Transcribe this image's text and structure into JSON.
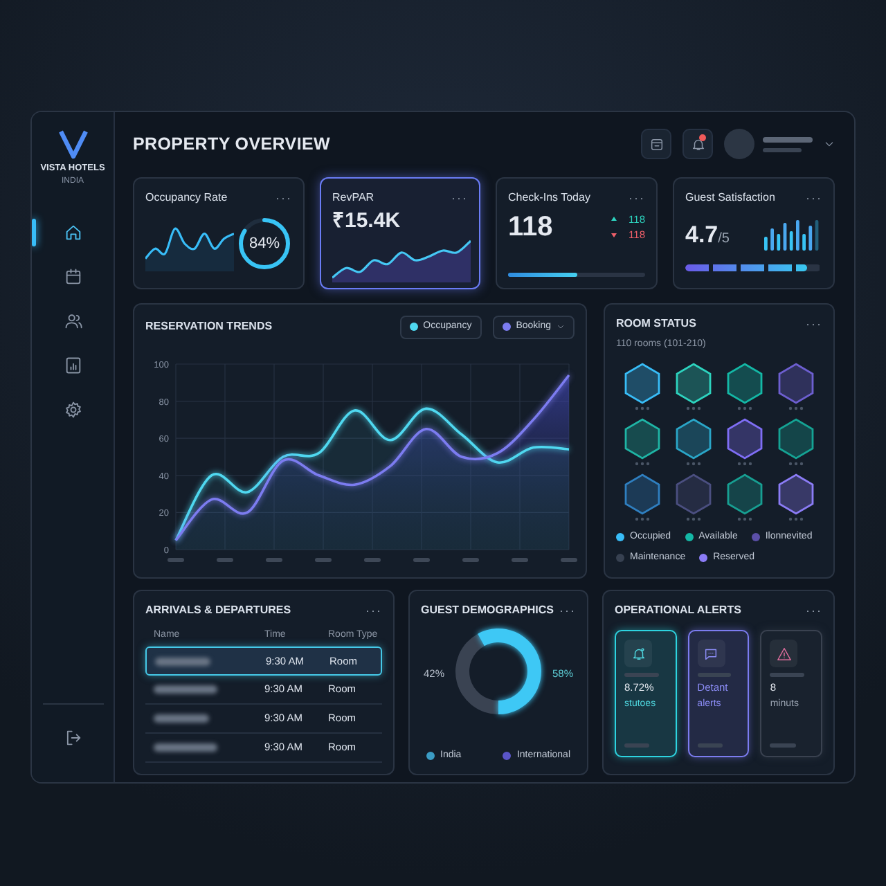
{
  "brand": {
    "name": "VISTA HOTELS",
    "region": "INDIA"
  },
  "sidebar": {
    "items": [
      {
        "kind": "home",
        "selected": true
      },
      {
        "kind": "calendar",
        "selected": false
      },
      {
        "kind": "users",
        "selected": false
      },
      {
        "kind": "report",
        "selected": false
      },
      {
        "kind": "settings",
        "selected": false
      }
    ]
  },
  "header": {
    "title": "PROPERTY OVERVIEW",
    "notification_badge": true
  },
  "kpis": [
    {
      "kind": "ring",
      "title": "Occupancy Rate",
      "more": "···",
      "value": "84%",
      "selected": false
    },
    {
      "kind": "trend",
      "title": "RevPAR",
      "more": "···",
      "value": "₹15.4K",
      "selected": true
    },
    {
      "kind": "checkins",
      "title": "Check-Ins Today",
      "more": "···",
      "value": "118",
      "up": "118",
      "down": "118",
      "level": 0.5,
      "selected": false
    },
    {
      "kind": "rating",
      "title": "Guest Satisfaction",
      "more": "···",
      "value": "4.7",
      "scale": "/5",
      "level": 0.9,
      "selected": false
    }
  ],
  "reservation_trends": {
    "legend": [
      {
        "dropdown": false
      },
      {
        "dropdown": true
      }
    ],
    "chart_data": {
      "type": "area",
      "title": "RESERVATION TRENDS",
      "grid": true,
      "ylim": [
        0,
        100
      ],
      "yticks": [
        0,
        20,
        40,
        60,
        80,
        100
      ],
      "series": [
        {
          "name": "Occupancy",
          "color": "#4fd8f0",
          "values": [
            5,
            40,
            31,
            50,
            52,
            75,
            59,
            76,
            62,
            47,
            55,
            54
          ]
        },
        {
          "name": "Booking",
          "color": "#7c7cf0",
          "values": [
            5,
            27,
            20,
            48,
            40,
            35,
            45,
            65,
            50,
            52,
            70,
            94
          ]
        }
      ]
    }
  },
  "room_status": {
    "title": "ROOM STATUS",
    "more": "···",
    "subtitle": "110 rooms (101-210)",
    "rooms": [
      {
        "color": "#38bdf8"
      },
      {
        "color": "#2dd4bf"
      },
      {
        "color": "#14b8a6"
      },
      {
        "color": "#6d5fd0"
      },
      {
        "color": "#1fb5a5"
      },
      {
        "color": "#2aa6c8"
      },
      {
        "color": "#7f6ef5"
      },
      {
        "color": "#15a394"
      },
      {
        "color": "#2f7fc0"
      },
      {
        "color": "#4b4f80"
      },
      {
        "color": "#179f92"
      },
      {
        "color": "#8b7cf6"
      }
    ],
    "legend": [
      {
        "label": "Occupied",
        "color": "#38bdf8"
      },
      {
        "label": "Available",
        "color": "#14b8a6"
      },
      {
        "label": "Ilonnevited",
        "color": "#5b4fa8"
      },
      {
        "label": "Maintenance",
        "color": "#374151"
      },
      {
        "label": "Reserved",
        "color": "#8b7cf6"
      }
    ]
  },
  "arrivals": {
    "title": "ARRIVALS & DEPARTURES",
    "more": "···",
    "columns": [
      "Name",
      "Time",
      "Room Type"
    ],
    "rows": [
      {
        "time": "9:30 AM",
        "room_type": "Room",
        "selected": true
      },
      {
        "time": "9:30 AM",
        "room_type": "Room",
        "selected": false
      },
      {
        "time": "9:30 AM",
        "room_type": "Room",
        "selected": false
      },
      {
        "time": "9:30 AM",
        "room_type": "Room",
        "selected": false
      }
    ]
  },
  "demographics": {
    "more": "···",
    "legend": [
      {
        "color": "#3b9cc4"
      },
      {
        "color": "#5a55c8"
      }
    ],
    "chart_data": {
      "type": "donut",
      "title": "GUEST DEMOGRAPHICS",
      "categories": [
        "India",
        "International"
      ],
      "values": [
        42,
        58
      ],
      "value_labels": [
        "42%",
        "58%"
      ],
      "colors": [
        "#3a4352",
        "#3ec8f5"
      ]
    }
  },
  "alerts": {
    "title": "OPERATIONAL ALERTS",
    "more": "···",
    "items": [
      {
        "kind": "bell",
        "color": "#2dd4e0",
        "value": "8.72%",
        "label": "stutoes"
      },
      {
        "kind": "chat",
        "color": "#7c7cf0",
        "value": "Detant",
        "label": "alerts"
      },
      {
        "kind": "warning",
        "color": "#3a4250",
        "value": "8",
        "label": "minuts"
      }
    ]
  }
}
